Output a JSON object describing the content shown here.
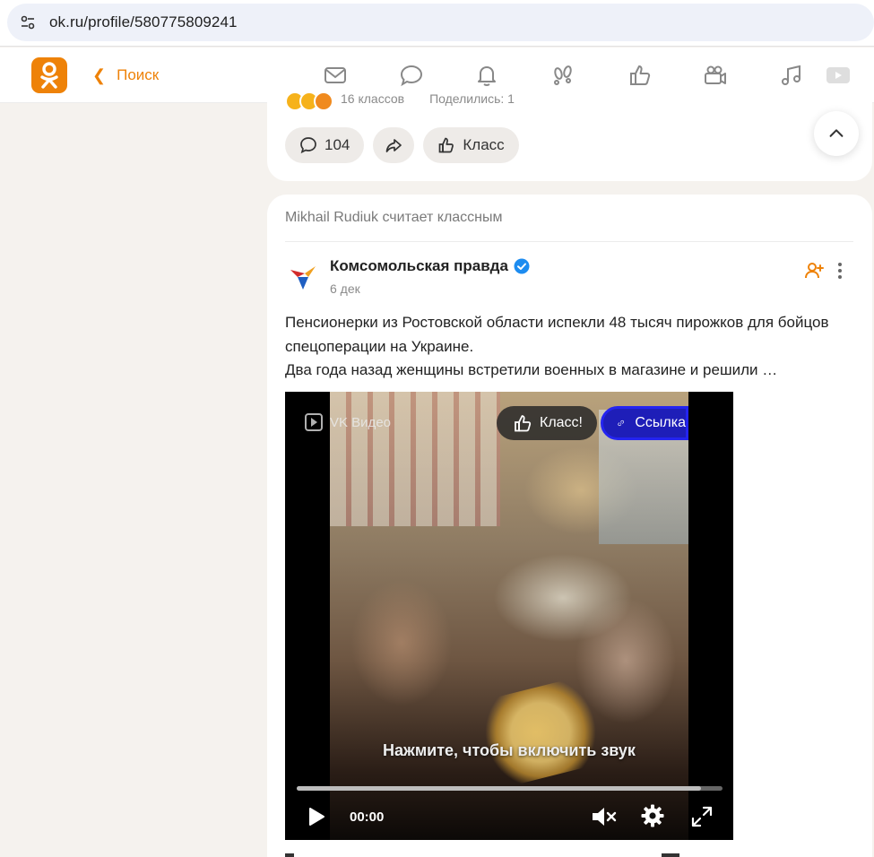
{
  "browser": {
    "url": "ok.ru/profile/580775809241"
  },
  "colors": {
    "brand_orange": "#ee8208",
    "verified_blue": "#1d8cf0",
    "link_button_blue": "#1e1eb8"
  },
  "nav": {
    "back_label": "Поиск",
    "icons": [
      "mail-icon",
      "chat-icon",
      "bell-icon",
      "guests-icon",
      "like-icon",
      "video-camera-icon",
      "music-icon",
      "video-play-icon"
    ]
  },
  "prev_post": {
    "reactions_count": "16 классов",
    "shares": "Поделились: 1",
    "comments_count": "104",
    "class_label": "Класс"
  },
  "post": {
    "liked_by": "Mikhail Rudiuk считает классным",
    "author": "Комсомольская правда",
    "date": "6 дек",
    "text_line1": "Пенсионерки из Ростовской области испекли 48 тысяч пирожков для бойцов",
    "text_line2": "спецоперации на Украине.",
    "text_line3": "Два года назад женщины встретили военных в магазине и решили …"
  },
  "video": {
    "provider": "VK Видео",
    "class_label": "Класс!",
    "link_label": "Ссылка",
    "unmute_hint": "Нажмите, чтобы включить звук",
    "time": "00:00",
    "buffered_fraction": 0.95
  }
}
